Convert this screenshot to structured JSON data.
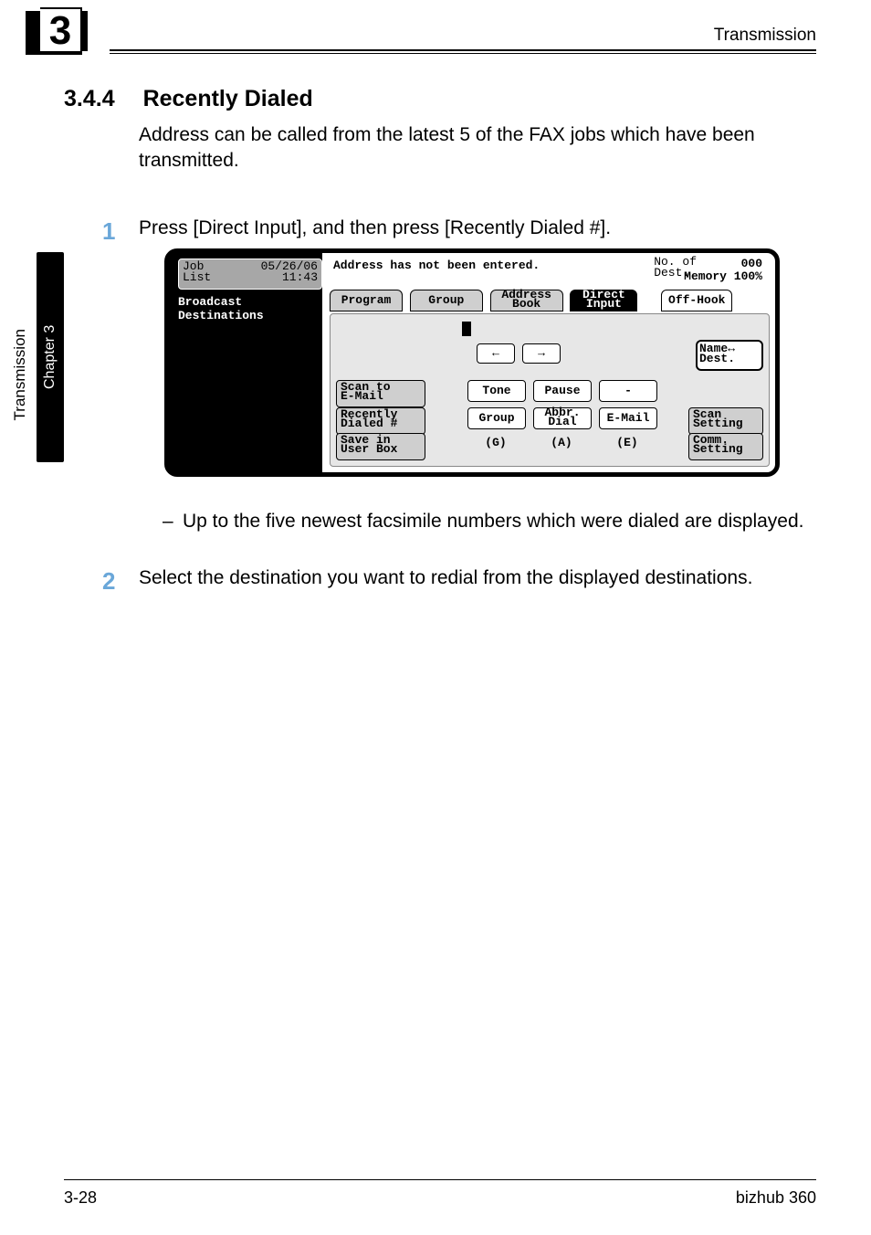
{
  "header": {
    "running_head": "Transmission",
    "chapter_badge_number": "3"
  },
  "sidebar": {
    "tab": "Chapter 3",
    "caption": "Transmission"
  },
  "section": {
    "number": "3.4.4",
    "title": "Recently Dialed"
  },
  "body": {
    "para1": "Address can be called from the latest 5 of the FAX jobs which have been transmitted.",
    "step1_num": "1",
    "step1_text": "Press [Direct Input], and then press [Recently Dialed #].",
    "bullet1": "Up to the five newest facsimile numbers which were dialed are displayed.",
    "step2_num": "2",
    "step2_text": "Select the destination you want to redial from the displayed destinations."
  },
  "lcd": {
    "job_list_l1": "Job",
    "job_list_l2": "List",
    "job_date": "05/26/06",
    "job_time": "11:43",
    "broadcast_l1": "Broadcast",
    "broadcast_l2": "Destinations",
    "message": "Address has not been entered.",
    "dest_label_l1": "No. of",
    "dest_label_l2": "Dest.",
    "dest_count": "000",
    "memory": "Memory 100%",
    "tabs": {
      "program": "Program",
      "group": "Group",
      "address_l1": "Address",
      "address_l2": "Book",
      "direct_l1": "Direct",
      "direct_l2": "Input",
      "offhook": "Off-Hook"
    },
    "name_btn_l1": "Name↔",
    "name_btn_l2": "Dest.",
    "arrow_left": "←",
    "arrow_right": "→",
    "side_btns": {
      "scan_l1": "Scan to",
      "scan_l2": "E-Mail",
      "recent_l1": "Recently",
      "recent_l2": "Dialed #",
      "save_l1": "Save in",
      "save_l2": "User Box"
    },
    "grid": {
      "tone": "Tone",
      "pause": "Pause",
      "dash": "-",
      "group": "Group",
      "abbr_l1": "Abbr.",
      "abbr_l2": "Dial",
      "email": "E-Mail",
      "g": "(G)",
      "a": "(A)",
      "e": "(E)"
    },
    "right_btns": {
      "scan_l1": "Scan",
      "scan_l2": "Setting",
      "comm_l1": "Comm.",
      "comm_l2": "Setting"
    }
  },
  "footer": {
    "left": "3-28",
    "right": "bizhub 360"
  }
}
